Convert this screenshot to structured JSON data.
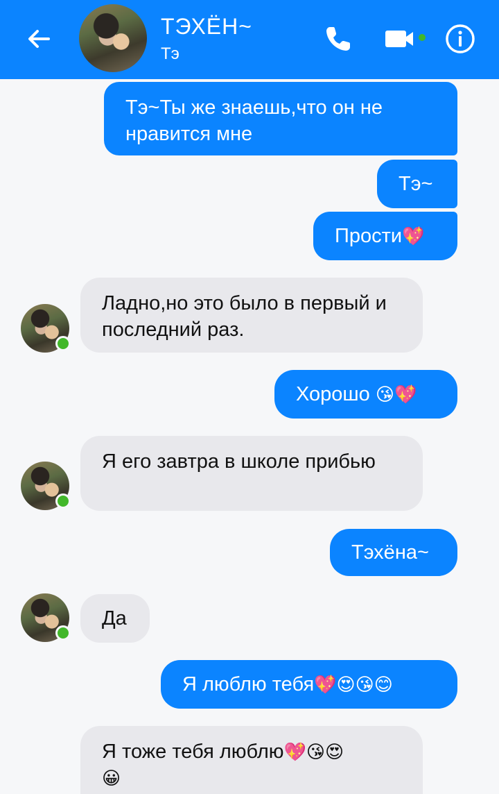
{
  "header": {
    "name": "ТЭХЁН~",
    "subtitle": "Тэ"
  },
  "messages": [
    {
      "dir": "out",
      "text": "Тэ~Ты же знаешь,что он не нравится мне"
    },
    {
      "dir": "out",
      "text": "Тэ~"
    },
    {
      "dir": "out",
      "text": "Прости",
      "emoji": "💖"
    },
    {
      "dir": "in",
      "text": "Ладно,но это было в первый и последний раз."
    },
    {
      "dir": "out",
      "text": "Хорошо ",
      "emoji": "😘💖"
    },
    {
      "dir": "in",
      "text": "Я его завтра в школе прибью"
    },
    {
      "dir": "out",
      "text": "Тэхёна~"
    },
    {
      "dir": "in",
      "text": "Да"
    },
    {
      "dir": "out",
      "text": "Я люблю тебя",
      "emoji": "💖😍😘😊"
    },
    {
      "dir": "in",
      "text": "Я тоже тебя люблю",
      "emoji": "💖😘😍",
      "emoji2": "😀"
    }
  ],
  "colors": {
    "accent": "#0b84ff",
    "incoming_bubble": "#e8e8ec",
    "online": "#42b72a"
  },
  "icons": [
    "back-arrow-icon",
    "phone-icon",
    "video-camera-icon",
    "info-icon"
  ]
}
